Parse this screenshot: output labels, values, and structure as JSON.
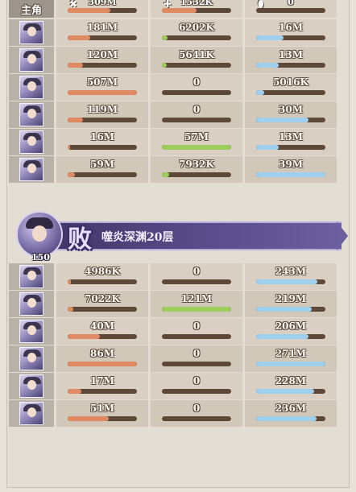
{
  "header": {
    "role_label": "主角",
    "columns": [
      {
        "icon": "crossed-swords-icon",
        "value": "309M",
        "fill": 0.62,
        "kind": "dmg"
      },
      {
        "icon": "heal-icon",
        "value": "1532K",
        "fill": 0.5,
        "kind": "heal"
      },
      {
        "icon": "shield-icon",
        "value": "0",
        "fill": 0.0,
        "kind": "tank"
      }
    ]
  },
  "team1": [
    {
      "avatar": "hero-avatar-1",
      "damage": "181M",
      "damage_fill": 0.33,
      "heal": "6202K",
      "heal_fill": 0.08,
      "tank": "16M",
      "tank_fill": 0.4
    },
    {
      "avatar": "hero-avatar-2",
      "damage": "120M",
      "damage_fill": 0.22,
      "heal": "5641K",
      "heal_fill": 0.07,
      "tank": "13M",
      "tank_fill": 0.33
    },
    {
      "avatar": "hero-avatar-3",
      "damage": "507M",
      "damage_fill": 1.0,
      "heal": "0",
      "heal_fill": 0.0,
      "tank": "5016K",
      "tank_fill": 0.12
    },
    {
      "avatar": "hero-avatar-4",
      "damage": "119M",
      "damage_fill": 0.22,
      "heal": "0",
      "heal_fill": 0.0,
      "tank": "30M",
      "tank_fill": 0.76
    },
    {
      "avatar": "hero-avatar-5",
      "damage": "16M",
      "damage_fill": 0.03,
      "heal": "57M",
      "heal_fill": 1.0,
      "tank": "13M",
      "tank_fill": 0.33
    },
    {
      "avatar": "hero-avatar-6",
      "damage": "59M",
      "damage_fill": 0.11,
      "heal": "7932K",
      "heal_fill": 0.1,
      "tank": "39M",
      "tank_fill": 1.0
    }
  ],
  "battle": {
    "boss_level": "150",
    "result": "败",
    "stage_name": "噬炎深渊20层"
  },
  "team2": [
    {
      "avatar": "hero-avatar-7",
      "damage": "4986K",
      "damage_fill": 0.05,
      "heal": "0",
      "heal_fill": 0.0,
      "tank": "243M",
      "tank_fill": 0.88
    },
    {
      "avatar": "hero-avatar-8",
      "damage": "7022K",
      "damage_fill": 0.08,
      "heal": "121M",
      "heal_fill": 1.0,
      "tank": "219M",
      "tank_fill": 0.8
    },
    {
      "avatar": "hero-avatar-9",
      "damage": "40M",
      "damage_fill": 0.46,
      "heal": "0",
      "heal_fill": 0.0,
      "tank": "206M",
      "tank_fill": 0.76
    },
    {
      "avatar": "hero-avatar-10",
      "damage": "86M",
      "damage_fill": 1.0,
      "heal": "0",
      "heal_fill": 0.0,
      "tank": "271M",
      "tank_fill": 1.0
    },
    {
      "avatar": "hero-avatar-11",
      "damage": "17M",
      "damage_fill": 0.2,
      "heal": "0",
      "heal_fill": 0.0,
      "tank": "228M",
      "tank_fill": 0.84
    },
    {
      "avatar": "hero-avatar-12",
      "damage": "51M",
      "damage_fill": 0.59,
      "heal": "0",
      "heal_fill": 0.0,
      "tank": "236M",
      "tank_fill": 0.87
    }
  ],
  "colors": {
    "damage": "#e08a63",
    "heal": "#9ccc5c",
    "tank": "#9ed0ee",
    "track": "#5e4837",
    "banner": "#4b4077"
  }
}
